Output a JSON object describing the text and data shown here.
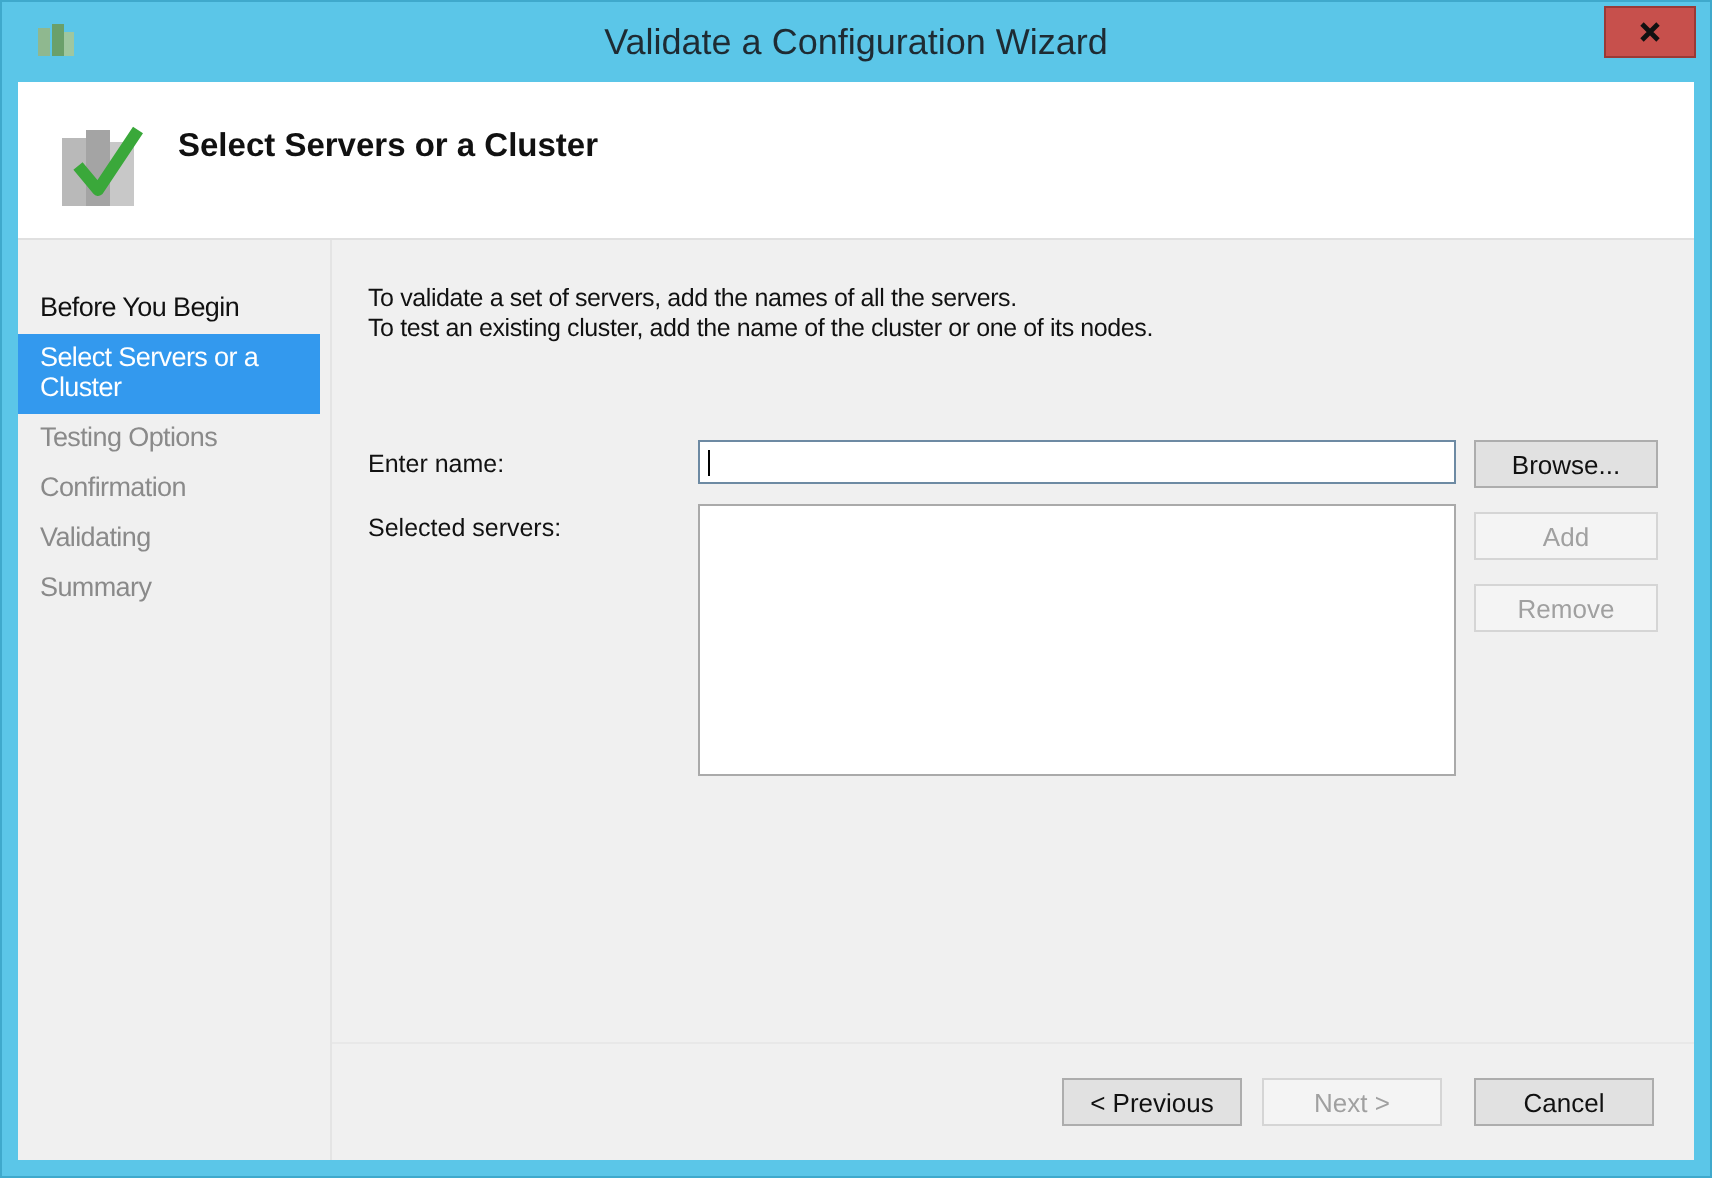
{
  "window": {
    "title": "Validate a Configuration Wizard"
  },
  "header": {
    "title": "Select Servers or a Cluster"
  },
  "steps": [
    {
      "label": "Before You Begin",
      "selected": false,
      "disabled": false
    },
    {
      "label": "Select Servers or a Cluster",
      "selected": true,
      "disabled": false
    },
    {
      "label": "Testing Options",
      "selected": false,
      "disabled": true
    },
    {
      "label": "Confirmation",
      "selected": false,
      "disabled": true
    },
    {
      "label": "Validating",
      "selected": false,
      "disabled": true
    },
    {
      "label": "Summary",
      "selected": false,
      "disabled": true
    }
  ],
  "instructions": [
    "To validate a set of servers, add the names of all the servers.",
    "To test an existing cluster, add the name of the cluster or one of its nodes."
  ],
  "name_field": {
    "label": "Enter name:"
  },
  "servers_list": {
    "label": "Selected servers:"
  },
  "side_buttons": [
    {
      "label": "Browse...",
      "disabled": false
    },
    {
      "label": "Add",
      "disabled": true
    },
    {
      "label": "Remove",
      "disabled": true
    }
  ],
  "footer_buttons": [
    {
      "label": "< Previous",
      "disabled": false
    },
    {
      "label": "Next >",
      "disabled": true
    },
    {
      "label": "Cancel",
      "disabled": false
    }
  ]
}
